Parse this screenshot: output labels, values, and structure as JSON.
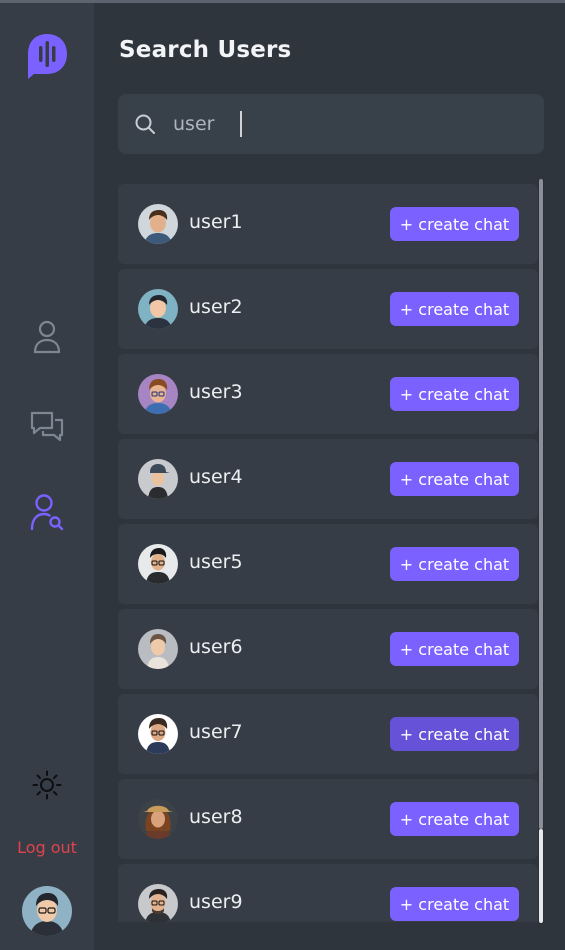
{
  "app": {
    "title": "Search Users",
    "accent": "#7b61ff",
    "danger": "#e0434d"
  },
  "sidebar": {
    "logo_icon": "chat-bubble-soundwave-icon",
    "nav": [
      {
        "icon": "user-profile-icon",
        "active": false
      },
      {
        "icon": "chats-icon",
        "active": false
      },
      {
        "icon": "user-search-icon",
        "active": true
      }
    ],
    "theme_icon": "sun-icon",
    "logout_label": "Log out",
    "me_avatar_icon": "user-avatar"
  },
  "search": {
    "icon": "search-icon",
    "value": "user",
    "placeholder": ""
  },
  "users": [
    {
      "name": "user1",
      "action": "+ create chat"
    },
    {
      "name": "user2",
      "action": "+ create chat"
    },
    {
      "name": "user3",
      "action": "+ create chat"
    },
    {
      "name": "user4",
      "action": "+ create chat"
    },
    {
      "name": "user5",
      "action": "+ create chat"
    },
    {
      "name": "user6",
      "action": "+ create chat"
    },
    {
      "name": "user7",
      "action": "+ create chat",
      "hovered": true
    },
    {
      "name": "user8",
      "action": "+ create chat"
    },
    {
      "name": "user9",
      "action": "+ create chat"
    }
  ]
}
